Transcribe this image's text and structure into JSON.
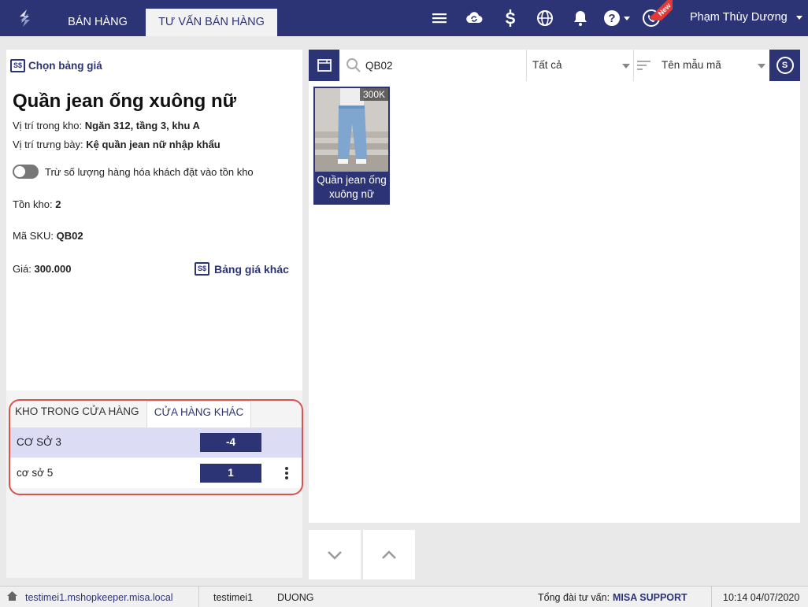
{
  "header": {
    "tabs": [
      {
        "label": "BÁN HÀNG"
      },
      {
        "label": "TƯ VẤN BÁN HÀNG"
      }
    ],
    "new_badge": "New",
    "user_name": "Phạm Thùy Dương",
    "brand_color": "#2d3476"
  },
  "product": {
    "choose_price_list": "Chọn bảng giá",
    "price_icon_text": "S$",
    "name": "Quần jean ống xuông nữ",
    "warehouse_location_label": "Vị trí trong kho:",
    "warehouse_location_value": "Ngăn 312, tầng 3, khu A",
    "display_location_label": "Vị trí trưng bày:",
    "display_location_value": "Kệ quần jean nữ nhập khẩu",
    "toggle_label": "Trừ số lượng hàng hóa khách đặt vào tồn kho",
    "stock_label": "Tồn kho:",
    "stock_value": "2",
    "sku_label": "Mã SKU:",
    "sku_value": "QB02",
    "price_label": "Giá:",
    "price_value": "300.000",
    "other_price_list": "Bảng giá khác"
  },
  "stock_tabs": {
    "tab1": "KHO TRONG CỬA HÀNG",
    "tab2": "CỬA HÀNG KHÁC",
    "rows": [
      {
        "name": "CƠ SỞ 3",
        "qty": "-4"
      },
      {
        "name": "cơ sở 5",
        "qty": "1"
      }
    ]
  },
  "search": {
    "query": "QB02",
    "filter": "Tất cả",
    "sort": "Tên mẫu mã",
    "right_icon_text": "S"
  },
  "items": [
    {
      "price_badge": "300K",
      "name": "Quần jean ống xuông nữ"
    }
  ],
  "status": {
    "url": "testimei1.mshopkeeper.misa.local",
    "shop": "testimei1",
    "user": "DUONG",
    "hotline_label": "Tổng đài tư vấn:",
    "hotline_value": "MISA SUPPORT",
    "datetime": "10:14 04/07/2020"
  }
}
